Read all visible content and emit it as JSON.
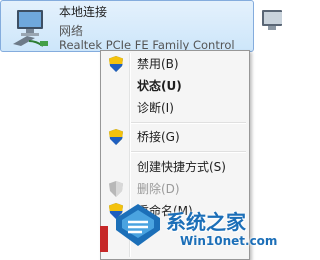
{
  "connection": {
    "name": "本地连接",
    "type": "网络",
    "adapter": "Realtek PCIe FE Family Control"
  },
  "context_menu": {
    "items": [
      {
        "label": "禁用(B)",
        "icon": "uac-shield-icon",
        "state": "normal"
      },
      {
        "label": "状态(U)",
        "state": "default"
      },
      {
        "label": "诊断(I)",
        "state": "normal"
      },
      {
        "label": "桥接(G)",
        "icon": "uac-shield-icon",
        "state": "normal"
      },
      {
        "label": "创建快捷方式(S)",
        "state": "normal"
      },
      {
        "label": "删除(D)",
        "icon": "uac-shield-icon",
        "state": "disabled"
      },
      {
        "label": "重命名(M)",
        "icon": "uac-shield-icon",
        "state": "normal"
      }
    ]
  },
  "watermark": {
    "title": "系统之家",
    "url": "Win10net.com"
  },
  "colors": {
    "selection_bg": "#cde6fa",
    "selection_border": "#84acdd",
    "menu_bg": "#f5f5f5",
    "watermark_blue": "#1c6fb8"
  }
}
